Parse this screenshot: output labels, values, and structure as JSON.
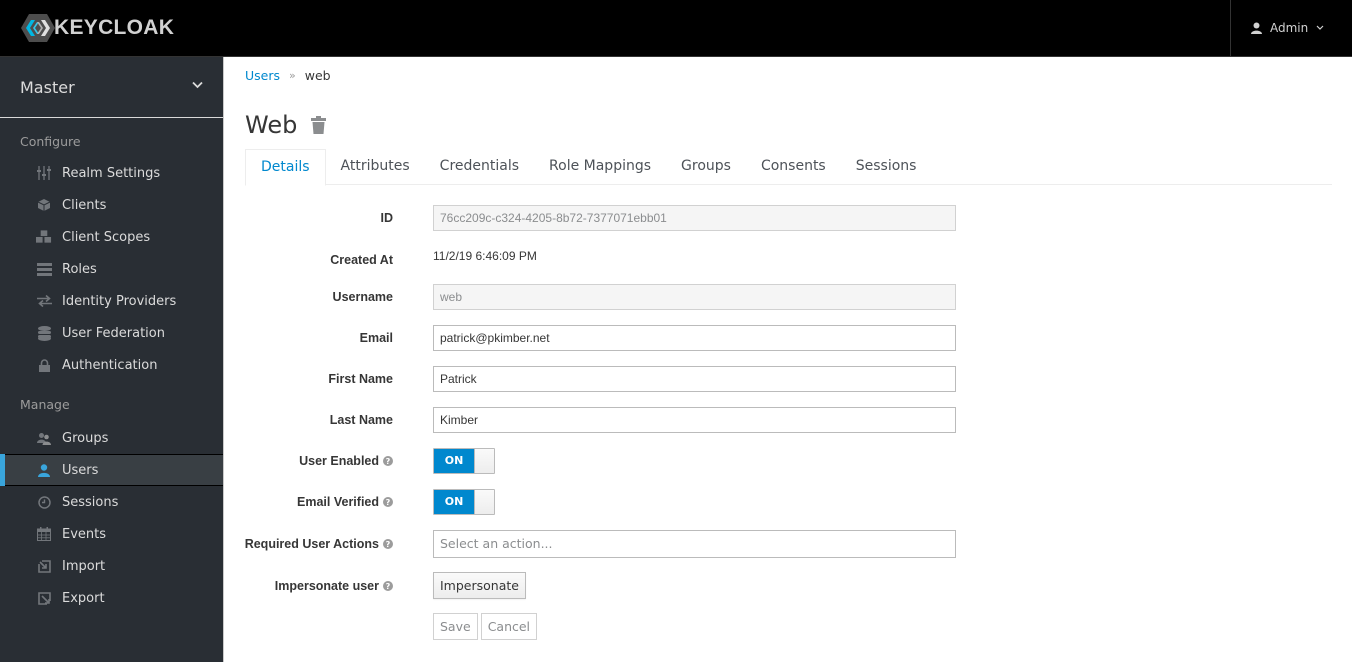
{
  "header": {
    "brand": "KEYCLOAK",
    "user_label": "Admin"
  },
  "sidebar": {
    "realm": "Master",
    "sections": [
      {
        "title": "Configure",
        "items": [
          {
            "label": "Realm Settings",
            "icon": "sliders-icon"
          },
          {
            "label": "Clients",
            "icon": "cube-icon"
          },
          {
            "label": "Client Scopes",
            "icon": "cubes-icon"
          },
          {
            "label": "Roles",
            "icon": "list-icon"
          },
          {
            "label": "Identity Providers",
            "icon": "exchange-icon"
          },
          {
            "label": "User Federation",
            "icon": "database-icon"
          },
          {
            "label": "Authentication",
            "icon": "lock-icon"
          }
        ]
      },
      {
        "title": "Manage",
        "items": [
          {
            "label": "Groups",
            "icon": "users-icon"
          },
          {
            "label": "Users",
            "icon": "user-icon",
            "active": true
          },
          {
            "label": "Sessions",
            "icon": "clock-icon"
          },
          {
            "label": "Events",
            "icon": "calendar-icon"
          },
          {
            "label": "Import",
            "icon": "import-icon"
          },
          {
            "label": "Export",
            "icon": "export-icon"
          }
        ]
      }
    ]
  },
  "breadcrumb": {
    "parent": "Users",
    "separator": "»",
    "current": "web"
  },
  "page": {
    "title": "Web"
  },
  "tabs": [
    "Details",
    "Attributes",
    "Credentials",
    "Role Mappings",
    "Groups",
    "Consents",
    "Sessions"
  ],
  "active_tab": "Details",
  "form": {
    "id_label": "ID",
    "id_value": "76cc209c-c324-4205-8b72-7377071ebb01",
    "created_label": "Created At",
    "created_value": "11/2/19 6:46:09 PM",
    "username_label": "Username",
    "username_value": "web",
    "email_label": "Email",
    "email_value": "patrick@pkimber.net",
    "first_name_label": "First Name",
    "first_name_value": "Patrick",
    "last_name_label": "Last Name",
    "last_name_value": "Kimber",
    "user_enabled_label": "User Enabled",
    "user_enabled_value": "ON",
    "email_verified_label": "Email Verified",
    "email_verified_value": "ON",
    "required_actions_label": "Required User Actions",
    "required_actions_placeholder": "Select an action...",
    "impersonate_label": "Impersonate user",
    "impersonate_button": "Impersonate",
    "save_button": "Save",
    "cancel_button": "Cancel"
  },
  "colors": {
    "accent": "#0088ce",
    "sidebar_bg": "#292e34",
    "active_indicator": "#39a5dc",
    "header_bg": "#000000"
  }
}
